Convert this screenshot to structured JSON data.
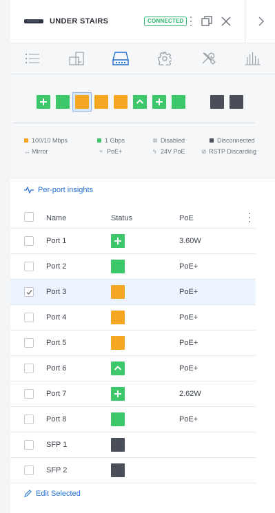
{
  "header": {
    "device_name": "UNDER STAIRS",
    "status_badge": "CONNECTED",
    "icons": [
      "device-icon",
      "kebab-menu-icon",
      "window-icon",
      "close-icon",
      "chevron-right-icon"
    ]
  },
  "tabs": [
    {
      "name": "list-icon",
      "active": false
    },
    {
      "name": "device-details-icon",
      "active": false
    },
    {
      "name": "ports-icon",
      "active": true
    },
    {
      "name": "gear-icon",
      "active": false
    },
    {
      "name": "tools-icon",
      "active": false
    },
    {
      "name": "stats-icon",
      "active": false
    }
  ],
  "colors": {
    "fast": "#f5a623",
    "gbps": "#3cc76a",
    "disabled": "#c8ccd1",
    "disconnected": "#4a4e58",
    "accent": "#1f6fd1",
    "selected_row": "#eef4fd"
  },
  "port_diagram": [
    {
      "status": "gbps",
      "glyph": "plus"
    },
    {
      "status": "gbps",
      "glyph": ""
    },
    {
      "status": "fast",
      "glyph": "",
      "selected": true
    },
    {
      "status": "fast",
      "glyph": ""
    },
    {
      "status": "fast",
      "glyph": ""
    },
    {
      "status": "gbps",
      "glyph": "chevron-up"
    },
    {
      "status": "gbps",
      "glyph": "plus"
    },
    {
      "status": "gbps",
      "glyph": ""
    },
    {
      "status": "disconnected",
      "glyph": ""
    },
    {
      "status": "disconnected",
      "glyph": ""
    }
  ],
  "legend": {
    "fast": "100/10 Mbps",
    "gbps": "1 Gbps",
    "disabled": "Disabled",
    "disconnected": "Disconnected",
    "mirror": "Mirror",
    "poe_plus": "PoE+",
    "poe_24v": "24V PoE",
    "rstp": "RSTP Discarding"
  },
  "insights_label": "Per-port insights",
  "table": {
    "headers": {
      "name": "Name",
      "status": "Status",
      "poe": "PoE"
    },
    "rows": [
      {
        "name": "Port 1",
        "status": "gbps",
        "glyph": "plus",
        "poe": "3.60W",
        "checked": false
      },
      {
        "name": "Port 2",
        "status": "gbps",
        "glyph": "",
        "poe": "PoE+",
        "checked": false
      },
      {
        "name": "Port 3",
        "status": "fast",
        "glyph": "",
        "poe": "PoE+",
        "checked": true
      },
      {
        "name": "Port 4",
        "status": "fast",
        "glyph": "",
        "poe": "PoE+",
        "checked": false
      },
      {
        "name": "Port 5",
        "status": "fast",
        "glyph": "",
        "poe": "PoE+",
        "checked": false
      },
      {
        "name": "Port 6",
        "status": "gbps",
        "glyph": "chevron-up",
        "poe": "PoE+",
        "checked": false
      },
      {
        "name": "Port 7",
        "status": "gbps",
        "glyph": "plus",
        "poe": "2.62W",
        "checked": false
      },
      {
        "name": "Port 8",
        "status": "gbps",
        "glyph": "",
        "poe": "PoE+",
        "checked": false
      },
      {
        "name": "SFP 1",
        "status": "disconnected",
        "glyph": "",
        "poe": "",
        "checked": false
      },
      {
        "name": "SFP 2",
        "status": "disconnected",
        "glyph": "",
        "poe": "",
        "checked": false
      }
    ]
  },
  "edit_label": "Edit Selected"
}
